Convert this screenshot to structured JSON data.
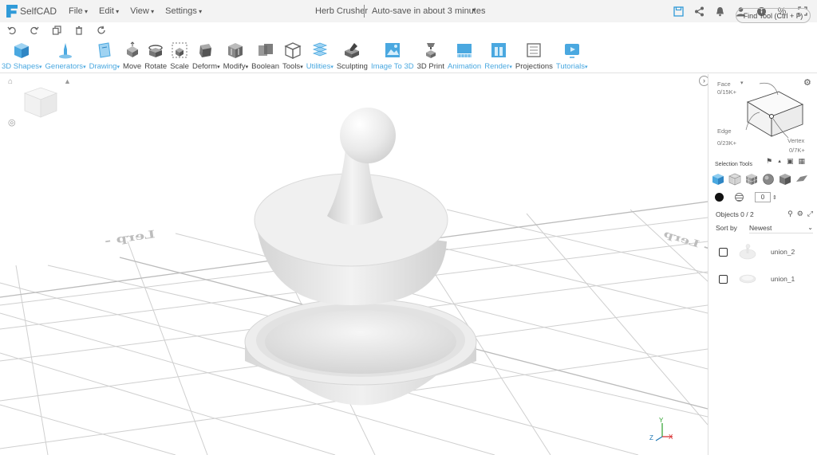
{
  "app": {
    "name": "SelfCAD",
    "doc_title": "Herb Crusher",
    "autosave": "Auto-save in about 3 minutes"
  },
  "menu": [
    "File",
    "Edit",
    "View",
    "Settings"
  ],
  "top_icons": [
    "save-icon",
    "share-icon",
    "bell-icon",
    "user-icon",
    "info-icon",
    "percent-icon",
    "fullscreen-icon"
  ],
  "undo_row": [
    "undo-icon",
    "redo-icon",
    "copy-icon",
    "trash-icon",
    "refresh-icon"
  ],
  "toolbar": {
    "tools": [
      {
        "label": "3D Shapes",
        "blue": true,
        "dropdown": true,
        "icon": "cube-icon"
      },
      {
        "label": "Generators",
        "blue": true,
        "dropdown": true,
        "icon": "generator-icon"
      },
      {
        "label": "Drawing",
        "blue": true,
        "dropdown": true,
        "icon": "drawing-icon"
      },
      {
        "label": "Move",
        "blue": false,
        "dropdown": false,
        "icon": "move-icon"
      },
      {
        "label": "Rotate",
        "blue": false,
        "dropdown": false,
        "icon": "rotate-icon"
      },
      {
        "label": "Scale",
        "blue": false,
        "dropdown": false,
        "icon": "scale-icon"
      },
      {
        "label": "Deform",
        "blue": false,
        "dropdown": true,
        "icon": "deform-icon"
      },
      {
        "label": "Modify",
        "blue": false,
        "dropdown": true,
        "icon": "modify-icon"
      },
      {
        "label": "Boolean",
        "blue": false,
        "dropdown": false,
        "icon": "boolean-icon"
      },
      {
        "label": "Tools",
        "blue": false,
        "dropdown": true,
        "icon": "tools-icon"
      },
      {
        "label": "Utilities",
        "blue": true,
        "dropdown": true,
        "icon": "utilities-icon"
      },
      {
        "label": "Sculpting",
        "blue": false,
        "dropdown": false,
        "icon": "sculpting-icon"
      },
      {
        "label": "Image To 3D",
        "blue": true,
        "dropdown": false,
        "icon": "image-to-3d-icon"
      },
      {
        "label": "3D Print",
        "blue": false,
        "dropdown": false,
        "icon": "3d-print-icon"
      },
      {
        "label": "Animation",
        "blue": true,
        "dropdown": false,
        "icon": "animation-icon"
      },
      {
        "label": "Render",
        "blue": true,
        "dropdown": true,
        "icon": "render-icon"
      },
      {
        "label": "Projections",
        "blue": false,
        "dropdown": false,
        "icon": "projections-icon"
      },
      {
        "label": "Tutorials",
        "blue": true,
        "dropdown": true,
        "icon": "tutorials-icon"
      }
    ],
    "find_tool": "Find Tool (Ctrl + F)"
  },
  "viewport": {
    "grid_text_left": "Lerp -",
    "grid_text_right": "- Lerp",
    "axes": {
      "x": "X",
      "y": "Y",
      "z": "Z"
    }
  },
  "selection": {
    "face_label": "Face",
    "face_count": "0/15K+",
    "edge_label": "Edge",
    "edge_count": "0/23K+",
    "vertex_label": "Vertex",
    "vertex_count": "0/7K+",
    "tools_title": "Selection Tools",
    "thickness_value": "0"
  },
  "objects": {
    "label": "Objects 0 / 2",
    "sort_label": "Sort by",
    "sort_value": "Newest",
    "items": [
      {
        "name": "union_2"
      },
      {
        "name": "union_1"
      }
    ]
  },
  "colors": {
    "accent": "#2f9ad8",
    "tool_blue": "#4aa8e0",
    "model": "#e8e8e8"
  }
}
